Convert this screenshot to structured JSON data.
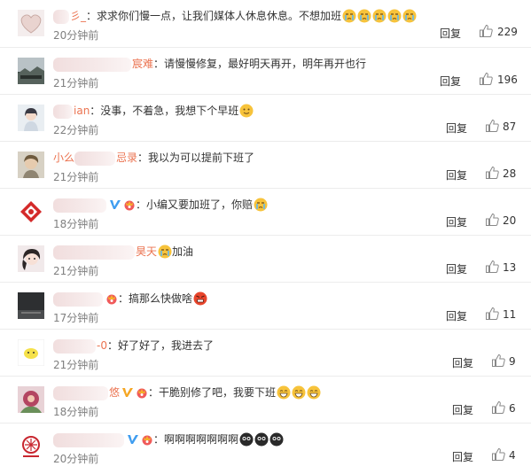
{
  "comments": [
    {
      "name_prefix": "",
      "name_suffix": "彡_",
      "text": "：求求你们慢一点，让我们媒体人休息休息。不想加班",
      "emojis": [
        "crying-emoji",
        "crying-emoji",
        "crying-emoji",
        "crying-emoji",
        "crying-emoji"
      ],
      "time": "20分钟前",
      "reply": "回复",
      "likes": "229",
      "avatar": "heart-avatar"
    },
    {
      "name_prefix": "",
      "name_suffix": "宸难",
      "text": "：请慢慢修复，最好明天再开，明年再开也行",
      "emojis": [],
      "time": "21分钟前",
      "reply": "回复",
      "likes": "196",
      "avatar": "landscape-avatar"
    },
    {
      "name_prefix": "",
      "name_suffix": "ian",
      "text": "：没事，不着急，我想下个早班",
      "emojis": [
        "smile-emoji"
      ],
      "time": "22分钟前",
      "reply": "回复",
      "likes": "87",
      "avatar": "girl-avatar"
    },
    {
      "name_prefix": "小么",
      "name_suffix": "忌录",
      "text": "：我以为可以提前下班了",
      "emojis": [],
      "time": "21分钟前",
      "reply": "回复",
      "likes": "28",
      "avatar": "portrait-avatar"
    },
    {
      "name_prefix": "",
      "name_suffix": "",
      "text": "：小编又要加班了，你赔",
      "emojis": [
        "crying-emoji"
      ],
      "time": "18分钟前",
      "reply": "回复",
      "likes": "20",
      "avatar": "red-logo-avatar",
      "verified": true,
      "vip": true
    },
    {
      "name_prefix": "",
      "name_suffix": "昊天",
      "text": "加油",
      "emojis": [
        "crying-emoji"
      ],
      "emoji_first": true,
      "time": "21分钟前",
      "reply": "回复",
      "likes": "13",
      "avatar": "anime-avatar"
    },
    {
      "name_prefix": "",
      "name_suffix": "",
      "text": "：搞那么快做啥",
      "emojis": [
        "angry-emoji"
      ],
      "time": "17分钟前",
      "reply": "回复",
      "likes": "11",
      "avatar": "dark-avatar",
      "vip": true
    },
    {
      "name_prefix": "",
      "name_suffix": "-0",
      "text": "：好了好了，我进去了",
      "emojis": [],
      "time": "21分钟前",
      "reply": "回复",
      "likes": "9",
      "avatar": "yellow-face-avatar"
    },
    {
      "name_prefix": "",
      "name_suffix": "悠",
      "text": "：干脆别修了吧，我要下班",
      "emojis": [
        "grin-emoji",
        "grin-emoji",
        "grin-emoji"
      ],
      "time": "18分钟前",
      "reply": "回复",
      "likes": "6",
      "avatar": "flower-avatar",
      "verified_gold": true,
      "vip": true
    },
    {
      "name_prefix": "",
      "name_suffix": "",
      "text": "：啊啊啊啊啊啊啊",
      "emojis": [
        "black-face-emoji",
        "black-face-emoji",
        "black-face-emoji"
      ],
      "time": "20分钟前",
      "reply": "回复",
      "likes": "4",
      "avatar": "red-emblem-avatar",
      "verified": true,
      "vip": true
    }
  ],
  "colors": {
    "name": "#eb7350",
    "verified_blue": "#3f9df0",
    "verified_gold": "#f5a623",
    "like_icon": "#888888"
  }
}
